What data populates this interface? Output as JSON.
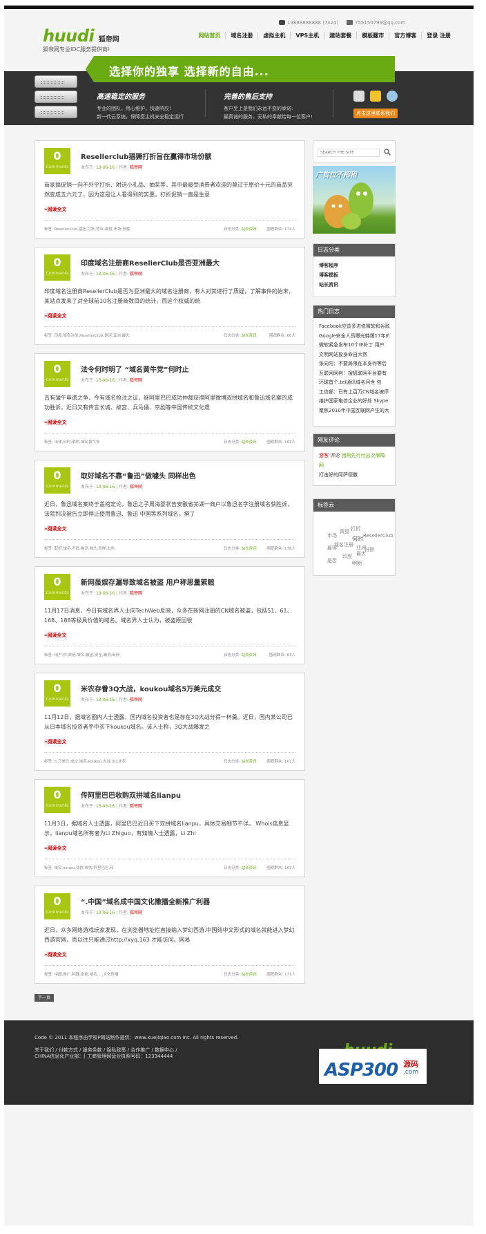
{
  "header": {
    "logo_main": "huudi",
    "logo_cn": "狐帝网",
    "slogan": "狐帝网专业IDC服务提供商!",
    "phone": "13888888888 (7x24)",
    "email": "755150799@qq.com",
    "nav": [
      "网站首页",
      "域名注册",
      "虚拟主机",
      "VPS主机",
      "建站套餐",
      "模板翻市",
      "官方博客",
      "登录 注册"
    ]
  },
  "banner": {
    "headline": "选择你的独享 选择新的自由...",
    "feature1": {
      "title": "高速稳定的服务",
      "lines": [
        "专业的团队，用心维护，快速响应!",
        "新一代云系统，保障您主机安全稳定运行"
      ]
    },
    "feature2": {
      "title": "完善的售后支持",
      "lines": [
        "客户至上是我们永远不变的承诺:",
        "最真诚的服务，无私的奉献给每一位客户!"
      ]
    },
    "contact_button": "点击这里联系我们"
  },
  "posts": [
    {
      "comments": "0",
      "comments_label": "Comments",
      "title": "Resellerclub猖獗打折旨在赢得市场份额",
      "date": "13-06-16",
      "author": "狐帝网",
      "excerpt": "商家搞促销一向不外乎打折、附送小礼品、抽奖等，其中最最受消费者欢迎的莫过于原价十元的商品突然变成五六元了，因为这是让人看得到的实惠。打折促销一直是生意",
      "read_more": "»阅读全文",
      "tags": "标签: Resellerclub,猖狂,打折,营业,赢得,市场,份额",
      "category": "日志分类:",
      "category_name": "站长资讯",
      "views": "围观群众: 174人"
    },
    {
      "comments": "0",
      "comments_label": "Comments",
      "title": "印度域名注册商ResellerClub是否亚洲最大",
      "date": "13-06-16",
      "author": "狐帝网",
      "excerpt": "印度域名注册商ResellerClub是否为亚洲最大的域名注册商，有人对其进行了质疑，了解事件的始末，某站点发来了对全球前10名注册商数目的统计，而这个权威的统",
      "read_more": "»阅读全文",
      "tags": "标签: 印度,域名注册,ResellerClub,是否,亚洲,最大",
      "category": "日志分类:",
      "category_name": "站长资讯",
      "views": "围观群众: 66人"
    },
    {
      "comments": "0",
      "comments_label": "Comments",
      "title": "法令何时明了 “域名黄牛党”何时止",
      "date": "13-06-16",
      "author": "狐帝网",
      "excerpt": "古有蒲午申遗之争，今有域名抢注之议，继阿里巴巴成功仲裁获得阿里微博双拼域名和鲁迅域名案的成功胜诉，近日又有传言长城、故宫、兵马俑、京剧等中国传统文化遗",
      "read_more": "»阅读全文",
      "tags": "标签: 法律,何时,明明,域名黄牛党",
      "category": "日志分类:",
      "category_name": "站长资讯",
      "views": "围观群众: 181人"
    },
    {
      "comments": "0",
      "comments_label": "Comments",
      "title": "取好域名不靠“鲁迅”做噱头 同样出色",
      "date": "13-06-16",
      "author": "狐帝网",
      "excerpt": "近日，鲁迅域名案终于盖棺定论，鲁迅之子周海婴状告安徽省芜湖一商户以鲁迅名字注册域名获胜诉，法院判决被告立即停止使用鲁迅、鲁迅 中国等系列域名。撰了",
      "read_more": "»阅读全文",
      "tags": "标签: 取好,域名,不靠,鲁迅,噱头,同样,出色",
      "category": "日志分类:",
      "category_name": "站长资讯",
      "views": "围观群众: 176人"
    },
    {
      "comments": "0",
      "comments_label": "Comments",
      "title": "新网虽娱存漏导致域名被盗 用户称思量索赔",
      "date": "13-06-16",
      "author": "狐帝网",
      "excerpt": "11月17日消息，今日有域名界人士向TechWeb反映，众多在新网注册的CN域名被盗，包括51、61、168、188等极具价值的域名。域名界人士认为，被盗原因很",
      "read_more": "»阅读全文",
      "tags": "标签: 用户,称,索赔,域名,被盗,安全,漏洞,新网",
      "category": "日志分类:",
      "category_name": "站长资讯",
      "views": "围观群众: 63人"
    },
    {
      "comments": "0",
      "comments_label": "Comments",
      "title": "米农存眷3Q大战，koukou域名5万美元成交",
      "date": "13-06-16",
      "author": "狐帝网",
      "excerpt": "11月12日，据域名圈内人士透露，国内域名投资者也是存在3Q大战分得一杯羹。近日，国内某公司已从日本域名投资者手中买下koukou域名。该人士称，3Q大战爆发之",
      "read_more": "»阅读全文",
      "tags": "标签: 5,万美元,成交,域名,koukou,大战,3Q,米农",
      "category": "日志分类:",
      "category_name": "站长资讯",
      "views": "围观群众: 101人"
    },
    {
      "comments": "0",
      "comments_label": "Comments",
      "title": "传阿里巴巴收购双拼域名lianpu",
      "date": "13-06-16",
      "author": "狐帝网",
      "excerpt": "11月3日，据域名人士透露，阿里巴巴近日买下双拼域名lianpu，具体交易细节不详。 Whois信息显示，lianpu域名所有者为Li Zhiguo，有知情人士透露，Li Zhi",
      "read_more": "»阅读全文",
      "tags": "标签: 域名,lianpu,双拼,收购,阿里巴巴,传",
      "category": "日志分类:",
      "category_name": "站长资讯",
      "views": "围观群众: 161人"
    },
    {
      "comments": "0",
      "comments_label": "Comments",
      "title": "“.中国”域名成中国文化撒播全新推广利器",
      "date": "13-06-16",
      "author": "狐帝网",
      "excerpt": "近日，众多网络游戏玩家发现，在浏览器地址栏直接输入梦幻西游.中国纯中文形式的域名就能进入梦幻西游官网，而以往只能通过http://xyq.163 才能访问。网易",
      "read_more": "»阅读全文",
      "tags": "标签: 中国,推广,利器,全新,域名,...,文化传播",
      "category": "日志分类:",
      "category_name": "站长资讯",
      "views": "围观群众: 171人"
    }
  ],
  "meta_labels": {
    "posted": "发布于:",
    "author": "作者:"
  },
  "pagination": {
    "next": "下一页"
  },
  "sidebar": {
    "search_placeholder": "SEARCH THE SITE",
    "ad_text": "广告位不招租",
    "categories_title": "日志分类",
    "categories": [
      "博客程序",
      "博客模板",
      "站长资讯"
    ],
    "hot_title": "热门日志",
    "hot": [
      "Facebook应该多进修微软和谷歌",
      "Google安全人员曝光韩爆17年的",
      "微软紧急发布10个IE补丁 用户",
      "文明网站投身命自大帮",
      "张向阳：不要局限在本身何等后",
      "互联网网判：搜狐联网平台要有",
      "环球首个.tel通讯域名问世 包",
      "工信部：已有上百万CN域名被停",
      "维护国家电信企业的好处 Skype",
      "聚焦2010年中国互联网产生的大"
    ],
    "comments_title": "网友评论",
    "comment_author": "游客",
    "comment_verb": "评论",
    "comment_target": "团购先行付出次保障网",
    "comment_text": "打击好的阿萨德撒",
    "tagcloud_title": "标签云",
    "tags": [
      "打折",
      "真猖",
      "市场",
      "ResellerClub",
      "何时",
      "赢得",
      "域名注册",
      "份额",
      "最大",
      "亚洲",
      "印度",
      "是否",
      "明明"
    ]
  },
  "footer": {
    "copyright": "Code © 2011 本程序由学校P网站制作提供：www.xuejiqiao.com Inc. All rights reserved.",
    "links": "关于我们 / 付款方式 / 服务条款 / 隐私政策 / 合作推广 / 数据中心 /",
    "icp": "CHINA信息化产业部：[ 工商管理网营业执照号码：123344444",
    "logo": "huudi"
  },
  "watermark": {
    "main": "ASP300",
    "cn": "源码",
    "sub": ".com"
  }
}
